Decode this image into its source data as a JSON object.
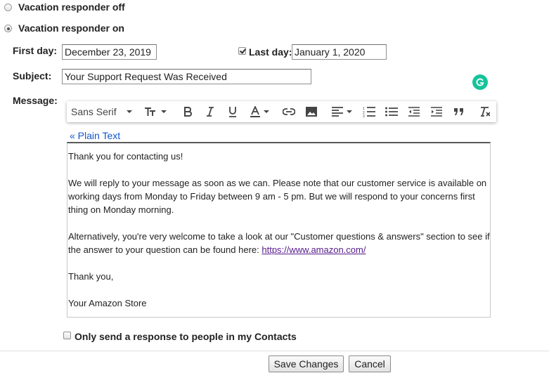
{
  "responder": {
    "off_label": "Vacation responder off",
    "on_label": "Vacation responder on"
  },
  "dates": {
    "first_day_label": "First day:",
    "first_day_value": "December 23, 2019",
    "last_day_label": "Last day:",
    "last_day_value": "January 1, 2020"
  },
  "subject": {
    "label": "Subject:",
    "value": "Your Support Request Was Received"
  },
  "message": {
    "label": "Message:",
    "plain_text_link": "« Plain Text",
    "lines": [
      "Thank you for contacting us!",
      "We will reply to your message as soon as we can. Please note that our customer service is available on",
      "working days from Monday to Friday between 9 am - 5 pm. But we will respond to your concerns first",
      "thing on Monday morning.",
      "Alternatively, you're very welcome to take a look at our \"Customer questions & answers\" section to see if",
      "the answer to your question can be found here: ",
      "Thank you,",
      "Your Amazon Store"
    ],
    "link_text": "https://www.amazon.com/"
  },
  "toolbar": {
    "font_name": "Sans Serif"
  },
  "contacts_only_label": "Only send a response to people in my Contacts",
  "buttons": {
    "save": "Save Changes",
    "cancel": "Cancel"
  },
  "colors": {
    "link": "#1a0dab",
    "plain_text_link": "#15c",
    "grammarly": "#15c39a"
  }
}
